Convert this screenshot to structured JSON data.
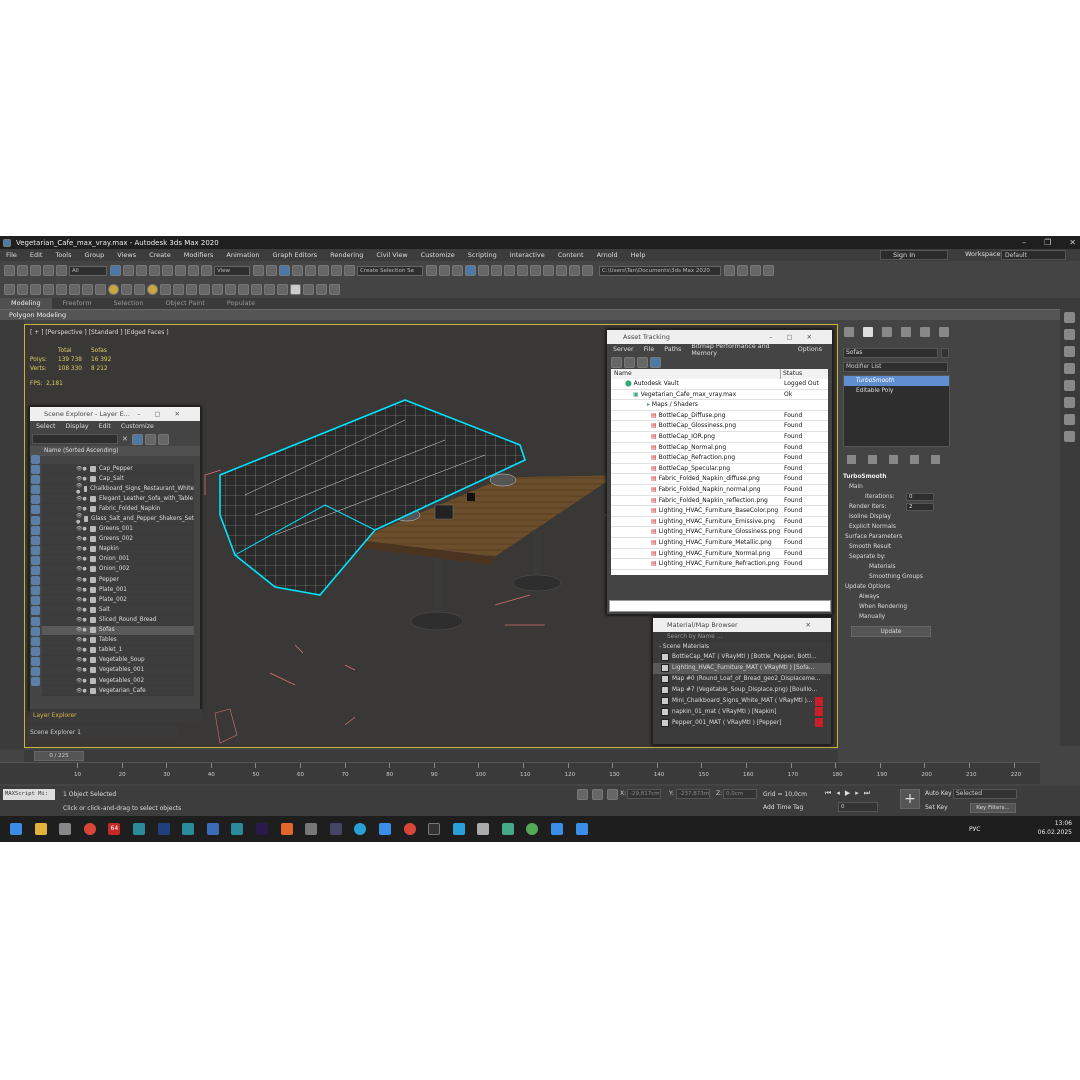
{
  "window": {
    "title": "Vegetarian_Cafe_max_vray.max - Autodesk 3ds Max 2020"
  },
  "menu": [
    "File",
    "Edit",
    "Tools",
    "Group",
    "Views",
    "Create",
    "Modifiers",
    "Animation",
    "Graph Editors",
    "Rendering",
    "Civil View",
    "Customize",
    "Scripting",
    "Interactive",
    "Content",
    "Arnold",
    "Help"
  ],
  "account": {
    "sign_in": "Sign In",
    "workspaces_label": "Workspaces:",
    "workspace": "Default"
  },
  "toolbar": {
    "filter": "All",
    "ref_coord": "View",
    "sel_set": "Create Selection Se",
    "project_path": "C:\\Users\\Tan\\Documents\\3ds Max 2020"
  },
  "ribbon_tabs": [
    "Modeling",
    "Freeform",
    "Selection",
    "Object Paint",
    "Populate"
  ],
  "ribbon_active": "Polygon Modeling",
  "viewport": {
    "label": "[ + ] [Perspective ] [Standard ] [Edged Faces ]",
    "stats_header": [
      "Total",
      "Sofas"
    ],
    "polys": [
      "Polys:",
      "139 738",
      "16 392"
    ],
    "verts": [
      "Verts:",
      "108 330",
      "8 212"
    ],
    "fps": [
      "FPS:",
      "2,181"
    ]
  },
  "scene_explorer": {
    "title": "Scene Explorer - Layer E...",
    "menu": [
      "Select",
      "Display",
      "Edit",
      "Customize"
    ],
    "column": "Name (Sorted Ascending)",
    "items": [
      "Cap_Pepper",
      "Cap_Salt",
      "Chalkboard_Signs_Restaurant_White",
      "Elegant_Leather_Sofa_with_Table",
      "Fabric_Folded_Napkin",
      "Glass_Salt_and_Pepper_Shakers_Set",
      "Greens_001",
      "Greens_002",
      "Napkin",
      "Onion_001",
      "Onion_002",
      "Pepper",
      "Plate_001",
      "Plate_002",
      "Salt",
      "Sliced_Round_Bread",
      "Sofas",
      "Tables",
      "tablet_1",
      "Vegetable_Soup",
      "Vegetables_001",
      "Vegetables_002",
      "Vegetarian_Cafe"
    ],
    "selected": "Sofas",
    "footer": "Layer Explorer",
    "explorer2": "Scene Explorer 1"
  },
  "asset_tracking": {
    "title": "Asset Tracking",
    "menu": [
      "Server",
      "File",
      "Paths",
      "Bitmap Performance and Memory",
      "Options"
    ],
    "columns": [
      "Name",
      "Status"
    ],
    "rows": [
      [
        "Autodesk Vault",
        "Logged Out",
        0
      ],
      [
        "Vegetarian_Cafe_max_vray.max",
        "Ok",
        1
      ],
      [
        "Maps / Shaders",
        "",
        2
      ],
      [
        "BottleCap_Diffuse.png",
        "Found",
        3
      ],
      [
        "BottleCap_Glossiness.png",
        "Found",
        3
      ],
      [
        "BottleCap_IOR.png",
        "Found",
        3
      ],
      [
        "BottleCap_Normal.png",
        "Found",
        3
      ],
      [
        "BottleCap_Refraction.png",
        "Found",
        3
      ],
      [
        "BottleCap_Specular.png",
        "Found",
        3
      ],
      [
        "Fabric_Folded_Napkin_diffuse.png",
        "Found",
        3
      ],
      [
        "Fabric_Folded_Napkin_normal.png",
        "Found",
        3
      ],
      [
        "Fabric_Folded_Napkin_reflection.png",
        "Found",
        3
      ],
      [
        "Lighting_HVAC_Furniture_BaseColor.png",
        "Found",
        3
      ],
      [
        "Lighting_HVAC_Furniture_Emissive.png",
        "Found",
        3
      ],
      [
        "Lighting_HVAC_Furniture_Glossiness.png",
        "Found",
        3
      ],
      [
        "Lighting_HVAC_Furniture_Metallic.png",
        "Found",
        3
      ],
      [
        "Lighting_HVAC_Furniture_Normal.png",
        "Found",
        3
      ],
      [
        "Lighting_HVAC_Furniture_Refraction.png",
        "Found",
        3
      ]
    ]
  },
  "material_browser": {
    "title": "Material/Map Browser",
    "search": "Search by Name ...",
    "category": "- Scene Materials",
    "items": [
      "BottleCap_MAT ( VRayMtl ) [Bottle_Pepper, Bottl...",
      "Lighting_HVAC_Furniture_MAT ( VRayMtl ) [Sofa...",
      "Map #0 (Round_Loaf_of_Bread_geo2_Displaceme...",
      "Map #7 (Vegetable_Soup_Displace.png) [Bouillo...",
      "Mini_Chalkboard_Signs_White_MAT ( VRayMtl )...",
      "napkin_01_mat ( VRayMtl ) [Napkin]",
      "Pepper_001_MAT ( VRayMtl ) [Pepper]"
    ]
  },
  "command_panel": {
    "object_name": "Sofas",
    "modifier_list": "Modifier List",
    "stack": [
      "TurboSmooth",
      "Editable Poly"
    ],
    "rollout": "TurboSmooth",
    "main": "Main",
    "iterations_label": "Iterations:",
    "iterations": "0",
    "render_iters_label": "Render Iters:",
    "render_iters": "2",
    "isoline": "Isoline Display",
    "explicit": "Explicit Normals",
    "surface": "Surface Parameters",
    "smooth": "Smooth Result",
    "separate": "Separate by:",
    "materials": "Materials",
    "smoothing": "Smoothing Groups",
    "update_opts": "Update Options",
    "always": "Always",
    "when_rendering": "When Rendering",
    "manually": "Manually",
    "update_btn": "Update"
  },
  "timeline": {
    "slider": "0 / 225",
    "ticks": [
      "10",
      "20",
      "30",
      "40",
      "50",
      "60",
      "70",
      "80",
      "90",
      "100",
      "110",
      "120",
      "130",
      "140",
      "150",
      "160",
      "170",
      "180",
      "190",
      "200",
      "210",
      "220"
    ]
  },
  "status": {
    "maxscript": "MAXScript Mi:",
    "selected": "1 Object Selected",
    "prompt": "Click or click-and-drag to select objects",
    "x_label": "X:",
    "y_label": "Y:",
    "z_label": "Z:",
    "x": "-29,817cm",
    "y": "-237,873m",
    "z": "0,0cm",
    "grid": "Grid = 10,0cm",
    "add_time_tag": "Add Time Tag",
    "frame": "0",
    "auto_key": "Auto Key",
    "set_key": "Set Key",
    "selected_set": "Selected",
    "key_filters": "Key Filters..."
  },
  "taskbar": {
    "badge": "64",
    "lang": "РУС",
    "time": "13:06",
    "date": "06.02.2025"
  },
  "colors": {
    "viewport_bg": "#3a3836",
    "selection": "#00e5ff",
    "accent": "#5f8fd0",
    "red": "#c8202a"
  }
}
